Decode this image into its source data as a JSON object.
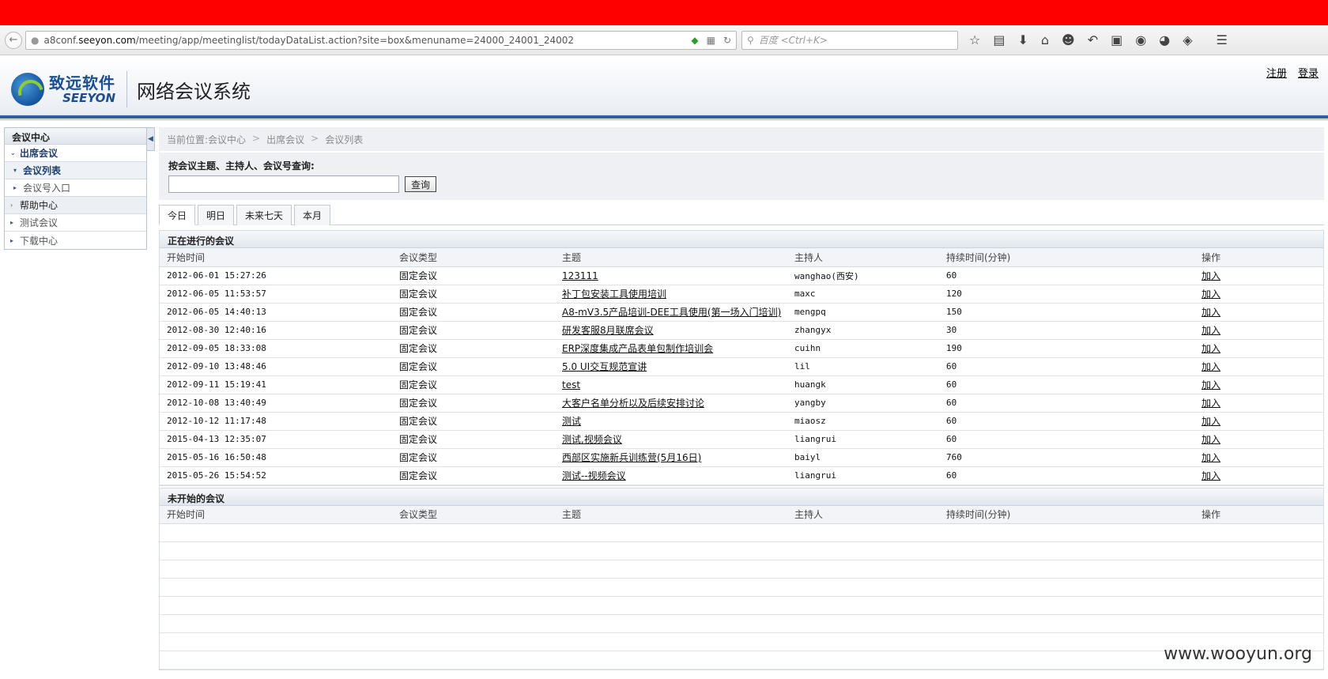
{
  "browser": {
    "url_prefix": "a8conf.",
    "url_host": "seeyon.com",
    "url_path": "/meeting/app/meetinglist/todayDataList.action?site=box&menuname=24000_24001_24002",
    "search_placeholder": "百度 <Ctrl+K>"
  },
  "header": {
    "logo_cn": "致远软件",
    "logo_en": "SEEYON",
    "system_title": "网络会议系统",
    "register_link": "注册",
    "login_link": "登录"
  },
  "sidebar": {
    "title": "会议中心",
    "items": [
      {
        "label": "出席会议"
      },
      {
        "label": "会议列表"
      },
      {
        "label": "会议号入口"
      },
      {
        "label": "帮助中心"
      },
      {
        "label": "测试会议"
      },
      {
        "label": "下载中心"
      }
    ]
  },
  "breadcrumb": {
    "prefix": "当前位置:会议中心",
    "sep": ">",
    "level2": "出席会议",
    "level3": "会议列表"
  },
  "search": {
    "label": "按会议主题、主持人、会议号查询:",
    "value": "",
    "button": "查询"
  },
  "tabs": [
    {
      "label": "今日"
    },
    {
      "label": "明日"
    },
    {
      "label": "未来七天"
    },
    {
      "label": "本月"
    }
  ],
  "columns": [
    "开始时间",
    "会议类型",
    "主题",
    "主持人",
    "持续时间(分钟)",
    "操作"
  ],
  "ongoing": {
    "title": "正在进行的会议",
    "rows": [
      {
        "time": "2012-06-01 15:27:26",
        "type": "固定会议",
        "topic": "123111",
        "host": "wanghao(西安)",
        "duration": "60",
        "action": "加入"
      },
      {
        "time": "2012-06-05 11:53:57",
        "type": "固定会议",
        "topic": "补丁包安装工具使用培训",
        "host": "maxc",
        "duration": "120",
        "action": "加入"
      },
      {
        "time": "2012-06-05 14:40:13",
        "type": "固定会议",
        "topic": "A8-mV3.5产品培训-DEE工具使用(第一场入门培训)",
        "host": "mengpq",
        "duration": "150",
        "action": "加入"
      },
      {
        "time": "2012-08-30 12:40:16",
        "type": "固定会议",
        "topic": "研发客服8月联席会议",
        "host": "zhangyx",
        "duration": "30",
        "action": "加入"
      },
      {
        "time": "2012-09-05 18:33:08",
        "type": "固定会议",
        "topic": "ERP深度集成产品表单包制作培训会",
        "host": "cuihn",
        "duration": "190",
        "action": "加入"
      },
      {
        "time": "2012-09-10 13:48:46",
        "type": "固定会议",
        "topic": "5.0 UI交互规范宣讲",
        "host": "lil",
        "duration": "60",
        "action": "加入"
      },
      {
        "time": "2012-09-11 15:19:41",
        "type": "固定会议",
        "topic": "test",
        "host": "huangk",
        "duration": "60",
        "action": "加入"
      },
      {
        "time": "2012-10-08 13:40:49",
        "type": "固定会议",
        "topic": "大客户名单分析以及后续安排讨论",
        "host": "yangby",
        "duration": "60",
        "action": "加入"
      },
      {
        "time": "2012-10-12 11:17:48",
        "type": "固定会议",
        "topic": "测试",
        "host": "miaosz",
        "duration": "60",
        "action": "加入"
      },
      {
        "time": "2015-04-13 12:35:07",
        "type": "固定会议",
        "topic": "测试,视频会议",
        "host": "liangrui",
        "duration": "60",
        "action": "加入"
      },
      {
        "time": "2015-05-16 16:50:48",
        "type": "固定会议",
        "topic": "西部区实施新兵训练营(5月16日)",
        "host": "baiyl",
        "duration": "760",
        "action": "加入"
      },
      {
        "time": "2015-05-26 15:54:52",
        "type": "固定会议",
        "topic": "测试--视频会议",
        "host": "liangrui",
        "duration": "60",
        "action": "加入"
      }
    ]
  },
  "upcoming": {
    "title": "未开始的会议",
    "rows": []
  },
  "watermark": "www.wooyun.org",
  "colors": {
    "top_bar": "#ff0000",
    "brand_blue": "#2f5e9e"
  }
}
